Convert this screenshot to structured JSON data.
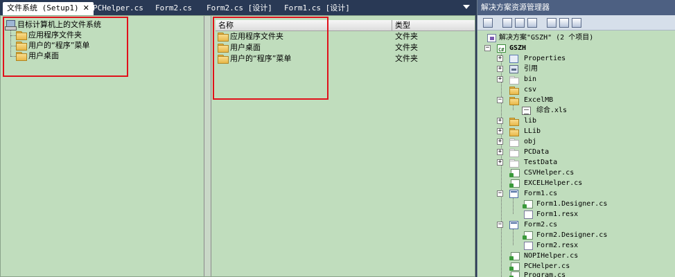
{
  "tabs": [
    {
      "label": "文件系统 (Setup1)",
      "active": true,
      "closable": true
    },
    {
      "label": "PCHelper.cs",
      "active": false
    },
    {
      "label": "Form2.cs",
      "active": false
    },
    {
      "label": "Form2.cs [设计]",
      "active": false
    },
    {
      "label": "Form1.cs [设计]",
      "active": false
    }
  ],
  "file_system": {
    "root": "目标计算机上的文件系统",
    "items": [
      "应用程序文件夹",
      "用户的“程序”菜单",
      "用户桌面"
    ]
  },
  "list": {
    "columns": {
      "name": "名称",
      "type": "类型"
    },
    "rows": [
      {
        "name": "应用程序文件夹",
        "type": "文件夹"
      },
      {
        "name": "用户桌面",
        "type": "文件夹"
      },
      {
        "name": "用户的“程序”菜单",
        "type": "文件夹"
      }
    ]
  },
  "solution_explorer": {
    "title": "解决方案资源管理器",
    "solution": "解决方案\"GSZH\" (2 个项目)",
    "project": "GSZH",
    "nodes": [
      {
        "label": "Properties"
      },
      {
        "label": "引用"
      },
      {
        "label": "bin"
      },
      {
        "label": "csv"
      },
      {
        "label": "ExcelMB"
      },
      {
        "label": "综合.xls"
      },
      {
        "label": "lib"
      },
      {
        "label": "LLib"
      },
      {
        "label": "obj"
      },
      {
        "label": "PCData"
      },
      {
        "label": "TestData"
      },
      {
        "label": "CSVHelper.cs"
      },
      {
        "label": "EXCELHelper.cs"
      },
      {
        "label": "Form1.cs"
      },
      {
        "label": "Form1.Designer.cs"
      },
      {
        "label": "Form1.resx"
      },
      {
        "label": "Form2.cs"
      },
      {
        "label": "Form2.Designer.cs"
      },
      {
        "label": "Form2.resx"
      },
      {
        "label": "NOPIHelper.cs"
      },
      {
        "label": "PCHelper.cs"
      },
      {
        "label": "Program.cs"
      }
    ]
  },
  "colors": {
    "highlight": "#e0101a",
    "pane_bg": "#c0ddbd",
    "tabstrip_bg": "#293955"
  }
}
